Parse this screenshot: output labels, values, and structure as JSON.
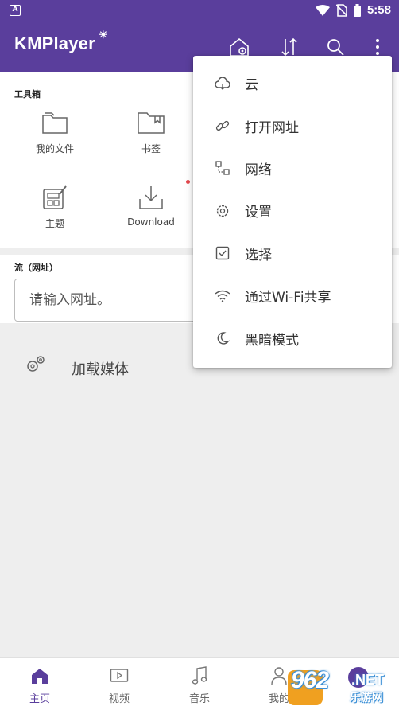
{
  "status_bar": {
    "time": "5:58",
    "left_icon": "A"
  },
  "app_bar": {
    "logo": "KMPlayer",
    "actions": [
      "home-settings-icon",
      "sort-icon",
      "search-icon",
      "more-vert-icon"
    ]
  },
  "toolbox": {
    "title": "工具箱",
    "items": [
      {
        "label": "我的文件",
        "icon": "folder-icon"
      },
      {
        "label": "书签",
        "icon": "bookmark-folder-icon"
      },
      {
        "label": "主题",
        "icon": "theme-icon"
      },
      {
        "label": "Download",
        "icon": "download-icon"
      }
    ]
  },
  "stream": {
    "title": "流（网址）",
    "placeholder": "请输入网址。"
  },
  "load_media": {
    "label": "加载媒体"
  },
  "menu": {
    "items": [
      {
        "label": "云",
        "icon": "cloud-icon"
      },
      {
        "label": "打开网址",
        "icon": "link-icon"
      },
      {
        "label": "网络",
        "icon": "network-icon"
      },
      {
        "label": "设置",
        "icon": "settings-icon"
      },
      {
        "label": "选择",
        "icon": "checkbox-icon"
      },
      {
        "label": "通过Wi-Fi共享",
        "icon": "wifi-icon"
      },
      {
        "label": "黑暗模式",
        "icon": "moon-icon"
      }
    ]
  },
  "bottom_nav": {
    "items": [
      {
        "label": "主页",
        "icon": "home-icon",
        "active": true
      },
      {
        "label": "视频",
        "icon": "video-icon",
        "active": false
      },
      {
        "label": "音乐",
        "icon": "music-icon",
        "active": false
      },
      {
        "label": "我的",
        "icon": "person-icon",
        "active": false
      }
    ]
  },
  "watermark": {
    "text": "962",
    "suffix": ".NET",
    "sub": "乐游网"
  },
  "colors": {
    "primary": "#5a3e9c",
    "background": "#eeeeee",
    "accent_dot": "#e5484d"
  }
}
